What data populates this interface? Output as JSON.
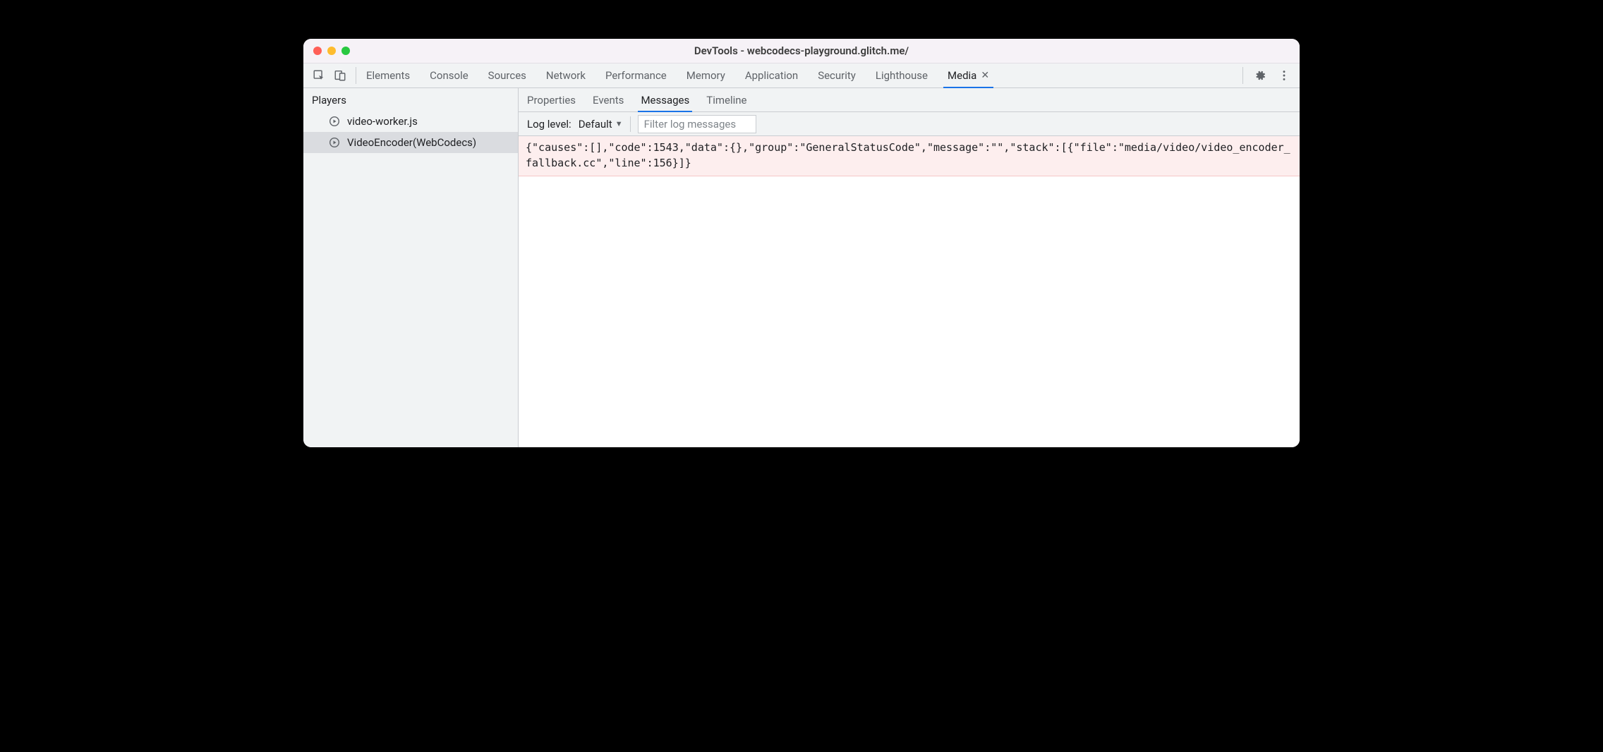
{
  "window": {
    "title": "DevTools - webcodecs-playground.glitch.me/"
  },
  "panels": {
    "elements": "Elements",
    "console": "Console",
    "sources": "Sources",
    "network": "Network",
    "performance": "Performance",
    "memory": "Memory",
    "application": "Application",
    "security": "Security",
    "lighthouse": "Lighthouse",
    "media": "Media"
  },
  "sidebar": {
    "header": "Players",
    "items": [
      {
        "label": "video-worker.js"
      },
      {
        "label": "VideoEncoder(WebCodecs)"
      }
    ]
  },
  "sub_tabs": {
    "properties": "Properties",
    "events": "Events",
    "messages": "Messages",
    "timeline": "Timeline"
  },
  "filter": {
    "label": "Log level:",
    "value": "Default",
    "placeholder": "Filter log messages"
  },
  "messages": [
    {
      "text": "{\"causes\":[],\"code\":1543,\"data\":{},\"group\":\"GeneralStatusCode\",\"message\":\"\",\"stack\":[{\"file\":\"media/video/video_encoder_fallback.cc\",\"line\":156}]}"
    }
  ]
}
